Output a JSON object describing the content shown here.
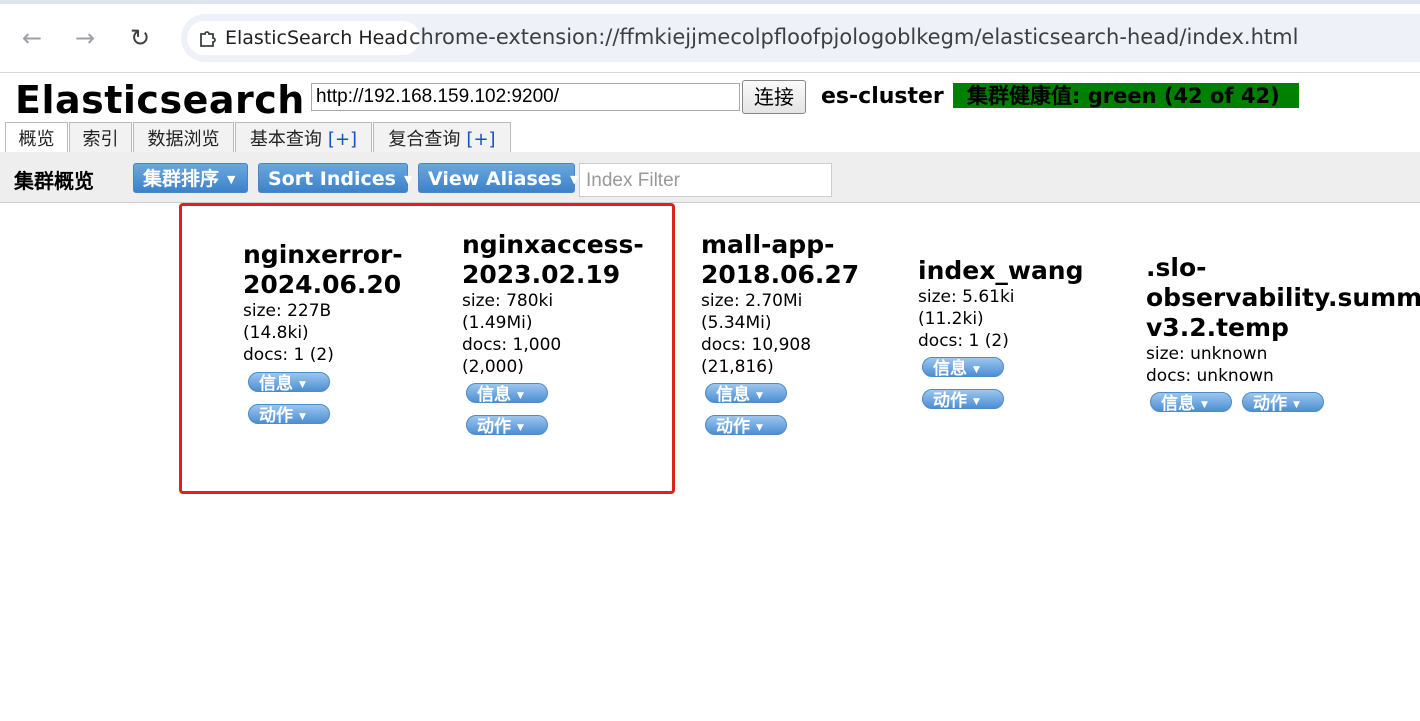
{
  "browser": {
    "tab_label": "ElasticSearch Head",
    "url": "chrome-extension://ffmkiejjmecolpfloofpjologoblkegm/elasticsearch-head/index.html"
  },
  "header": {
    "title": "Elasticsearch",
    "connect_url": "http://192.168.159.102:9200/",
    "connect_label": "连接",
    "cluster_name": "es-cluster",
    "health": "集群健康值: green (42 of 42)",
    "health_color": "#008000"
  },
  "tabs": [
    {
      "label": "概览",
      "plus": ""
    },
    {
      "label": "索引",
      "plus": ""
    },
    {
      "label": "数据浏览",
      "plus": ""
    },
    {
      "label": "基本查询",
      "plus": "[+]"
    },
    {
      "label": "复合查询",
      "plus": "[+]"
    }
  ],
  "toolbar": {
    "title": "集群概览",
    "sort_cluster": "集群排序",
    "sort_indices": "Sort Indices",
    "view_aliases": "View Aliases",
    "filter_placeholder": "Index Filter"
  },
  "indices": [
    {
      "name_1": "nginxerror-",
      "name_2": "2024.06.20",
      "name_3": "",
      "size_1": "size: 227B",
      "size_2": "(14.8ki)",
      "docs_1": "docs: 1 (2)",
      "docs_2": "",
      "info": "信息",
      "action": "动作"
    },
    {
      "name_1": "nginxaccess-",
      "name_2": "2023.02.19",
      "name_3": "",
      "size_1": "size: 780ki",
      "size_2": "(1.49Mi)",
      "docs_1": "docs: 1,000",
      "docs_2": "(2,000)",
      "info": "信息",
      "action": "动作"
    },
    {
      "name_1": "mall-app-",
      "name_2": "2018.06.27",
      "name_3": "",
      "size_1": "size: 2.70Mi",
      "size_2": "(5.34Mi)",
      "docs_1": "docs: 10,908",
      "docs_2": "(21,816)",
      "info": "信息",
      "action": "动作"
    },
    {
      "name_1": "index_wang",
      "name_2": "",
      "name_3": "",
      "size_1": "size: 5.61ki",
      "size_2": "(11.2ki)",
      "docs_1": "docs: 1 (2)",
      "docs_2": "",
      "info": "信息",
      "action": "动作"
    },
    {
      "name_1": ".slo-",
      "name_2": "observability.summa",
      "name_3": "v3.2.temp",
      "size_1": "size: unknown",
      "size_2": "",
      "docs_1": "docs: unknown",
      "docs_2": "",
      "info": "信息",
      "action": "动作"
    }
  ],
  "colors": {
    "highlight_border": "#e0201b",
    "button_blue": "#3d82c9"
  }
}
